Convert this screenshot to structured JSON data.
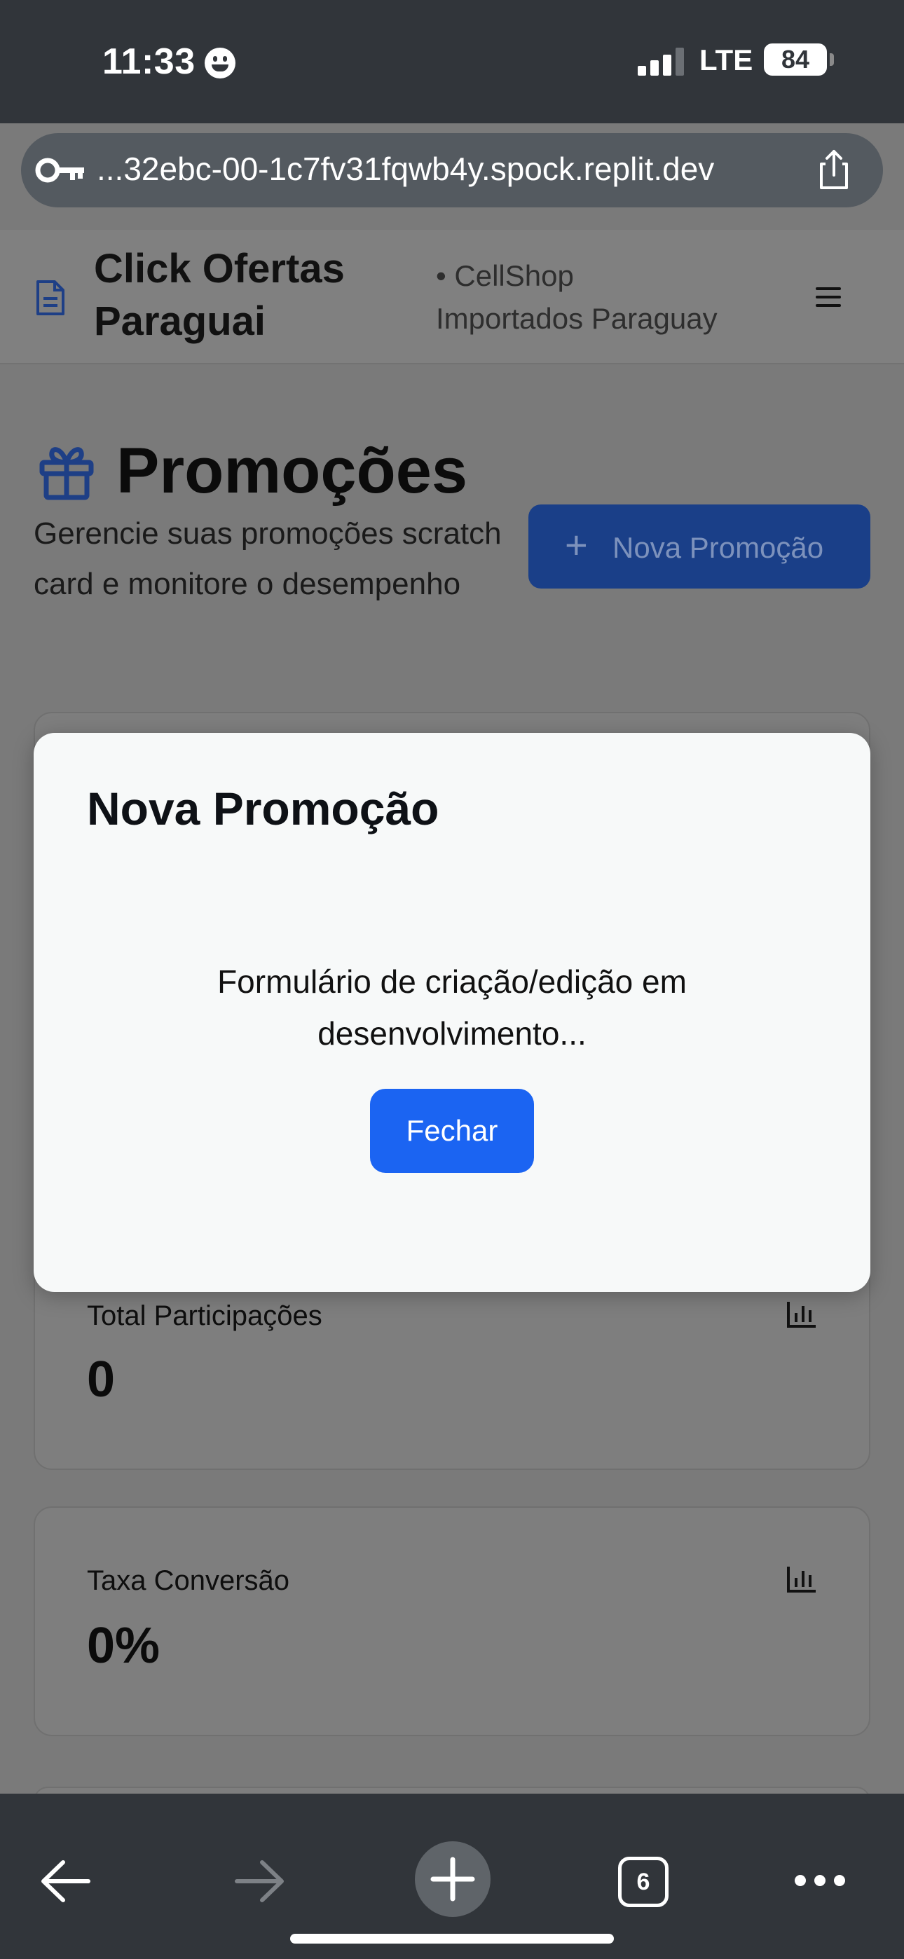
{
  "status_bar": {
    "time": "11:33",
    "network": "LTE",
    "battery": "84"
  },
  "browser": {
    "url": "...32ebc-00-1c7fv31fqwb4y.spock.replit.dev",
    "tab_count": "6"
  },
  "header": {
    "brand_line1": "Click Ofertas",
    "brand_line2": "Paraguai",
    "store_line1": "• CellShop",
    "store_line2": "Importados Paraguay"
  },
  "page": {
    "title": "Promoções",
    "subtitle": "Gerencie suas promoções scratch card e monitore o desempenho",
    "new_button": "Nova Promoção"
  },
  "stats": [
    {
      "label": "Total Participações",
      "value": "0"
    },
    {
      "label": "Taxa Conversão",
      "value": "0%"
    }
  ],
  "modal": {
    "title": "Nova Promoção",
    "message_line1": "Formulário de criação/edição em",
    "message_line2": "desenvolvimento...",
    "close_button": "Fechar"
  },
  "colors": {
    "primary": "#1b64f2",
    "icon_blue": "#1e40af",
    "chrome": "#31353a"
  }
}
